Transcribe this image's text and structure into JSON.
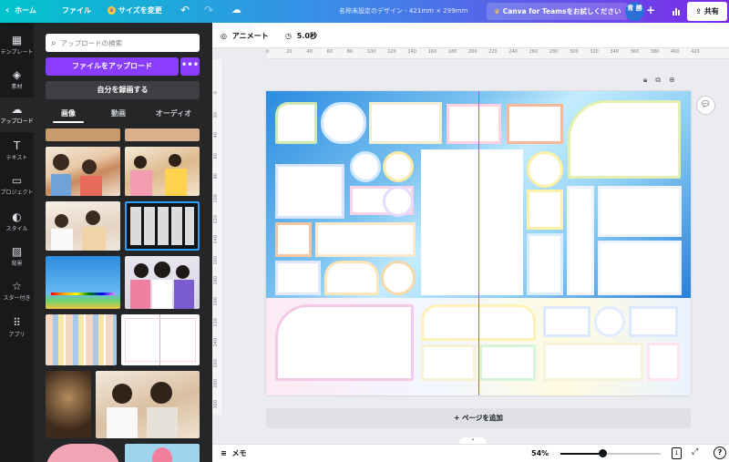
{
  "topbar": {
    "home": "ホーム",
    "file": "ファイル",
    "resize": "サイズを変更",
    "title": "名称未設定のデザイン - 421mm × 299mm",
    "teams": "Canva for Teamsをお試しください",
    "avatar": "青 勝",
    "share": "共有"
  },
  "rail": [
    {
      "label": "テンプレート",
      "icon": "template-icon",
      "glyph": "▦"
    },
    {
      "label": "素材",
      "icon": "elements-icon",
      "glyph": "◈"
    },
    {
      "label": "アップロード",
      "icon": "upload-icon",
      "glyph": "☁"
    },
    {
      "label": "テキスト",
      "icon": "text-icon",
      "glyph": "T"
    },
    {
      "label": "プロジェクト",
      "icon": "folder-icon",
      "glyph": "▭"
    },
    {
      "label": "スタイル",
      "icon": "palette-icon",
      "glyph": "◐"
    },
    {
      "label": "背景",
      "icon": "background-icon",
      "glyph": "▨"
    },
    {
      "label": "スター付き",
      "icon": "star-icon",
      "glyph": "☆"
    },
    {
      "label": "アプリ",
      "icon": "apps-icon",
      "glyph": "⠿"
    }
  ],
  "panel": {
    "search_placeholder": "アップロードの検索",
    "upload_button": "ファイルをアップロード",
    "upload_more": "•••",
    "record_button": "自分を録画する",
    "tabs": [
      "画像",
      "動画",
      "オーディオ"
    ]
  },
  "canvas": {
    "animate": "アニメート",
    "duration": "5.0秒",
    "ruler_h": [
      "0",
      "20",
      "40",
      "60",
      "80",
      "100",
      "120",
      "140",
      "160",
      "180",
      "200",
      "220",
      "240",
      "260",
      "280",
      "300",
      "320",
      "340",
      "360",
      "380",
      "400",
      "420"
    ],
    "ruler_v": [
      "0",
      "20",
      "40",
      "60",
      "80",
      "100",
      "120",
      "140",
      "160",
      "180",
      "200",
      "220",
      "240",
      "260",
      "280",
      "300"
    ],
    "add_page": "+ ページを追加"
  },
  "bottombar": {
    "memo": "メモ",
    "zoom": "54%",
    "zoom_level": 0.42,
    "page_count": "1",
    "help": "?"
  },
  "colors": {
    "accent": "#8b3dff",
    "dark": "#252627",
    "guide": "#a45be0"
  }
}
